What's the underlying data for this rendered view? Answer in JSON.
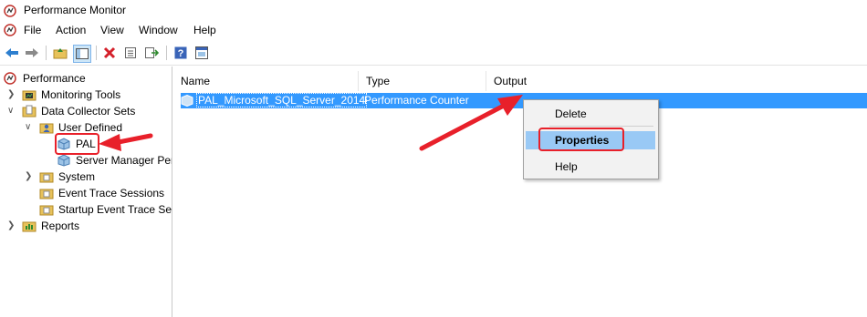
{
  "window": {
    "title": "Performance Monitor"
  },
  "menu": [
    "File",
    "Action",
    "View",
    "Window",
    "Help"
  ],
  "toolbar": {
    "icons": [
      "back-icon",
      "forward-icon",
      "up-folder-icon",
      "show-hide-tree-icon",
      "delete-icon",
      "properties-icon",
      "export-icon",
      "help-icon",
      "console-icon"
    ]
  },
  "tree": {
    "root": "Performance",
    "monitoring_tools": "Monitoring Tools",
    "data_collector_sets": "Data Collector Sets",
    "user_defined": "User Defined",
    "pal": "PAL",
    "server_manager": "Server Manager Per",
    "system": "System",
    "event_trace": "Event Trace Sessions",
    "startup_event_trace": "Startup Event Trace Ses",
    "reports": "Reports"
  },
  "list": {
    "columns": [
      "Name",
      "Type",
      "Output"
    ],
    "rows": [
      {
        "name": "PAL_Microsoft_SQL_Server_2014",
        "type": "Performance Counter",
        "output": ""
      }
    ]
  },
  "context_menu": {
    "items": [
      "Delete",
      "Properties",
      "Help"
    ],
    "highlighted": "Properties"
  },
  "annotation_color": "#e8202a",
  "selection_color": "#3399ff"
}
